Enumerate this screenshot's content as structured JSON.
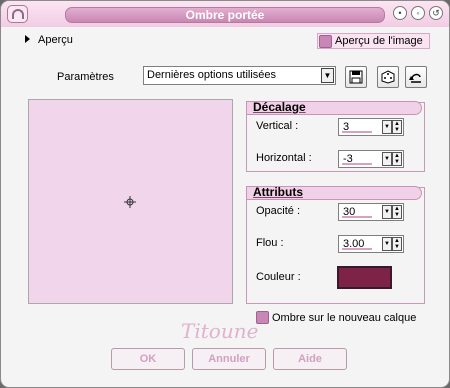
{
  "window": {
    "title": "Ombre portée"
  },
  "preview_toggle": {
    "label": "Aperçu"
  },
  "apercu_image": {
    "label": "Aperçu de l'image"
  },
  "parametres": {
    "label": "Paramètres",
    "value": "Dernières options utilisées"
  },
  "decalage": {
    "title": "Décalage",
    "vertical_label": "Vertical :",
    "vertical_value": "3",
    "horizontal_label": "Horizontal :",
    "horizontal_value": "-3"
  },
  "attributs": {
    "title": "Attributs",
    "opacite_label": "Opacité :",
    "opacite_value": "30",
    "flou_label": "Flou :",
    "flou_value": "3.00",
    "couleur_label": "Couleur :",
    "couleur_hex": "#7d2347"
  },
  "new_layer": {
    "label": "Ombre sur le nouveau calque"
  },
  "signature": "Titoune",
  "buttons": {
    "ok": "OK",
    "cancel": "Annuler",
    "help": "Aide"
  },
  "colors": {
    "accent": "#c987b6",
    "title_bar": "#f2cce3",
    "preview_bg": "#f1d6eb"
  }
}
